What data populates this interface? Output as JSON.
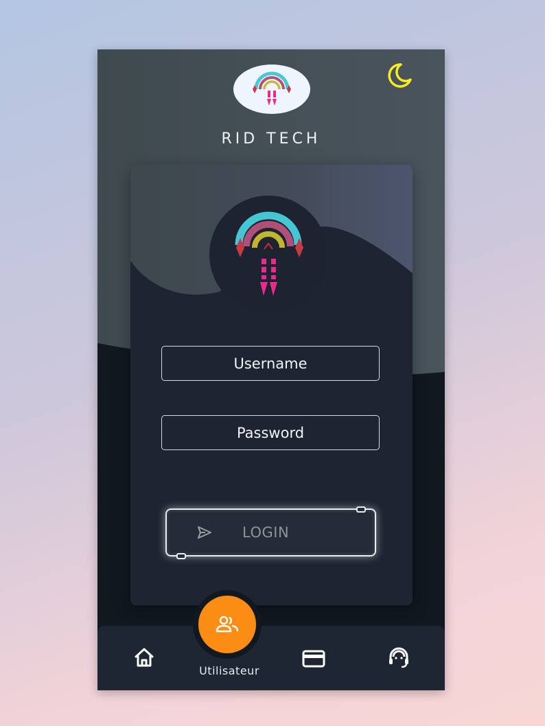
{
  "app": {
    "brand_name": "RID TECH",
    "logo_icon": "rainbow-rocket-logo",
    "theme_toggle_icon": "moon-icon"
  },
  "login_form": {
    "username_placeholder": "Username",
    "password_placeholder": "Password",
    "login_label": "LOGIN",
    "login_icon": "send-icon"
  },
  "bottom_nav": {
    "items": [
      {
        "icon": "home-icon",
        "label": ""
      },
      {
        "icon": "users-icon",
        "label": "Utilisateur",
        "active": true
      },
      {
        "icon": "credit-card-icon",
        "label": ""
      },
      {
        "icon": "support-headset-icon",
        "label": ""
      }
    ]
  },
  "colors": {
    "accent": "#fb8c14",
    "moon": "#f7ec21",
    "panel": "#1e2431",
    "background_dark": "#111820"
  }
}
